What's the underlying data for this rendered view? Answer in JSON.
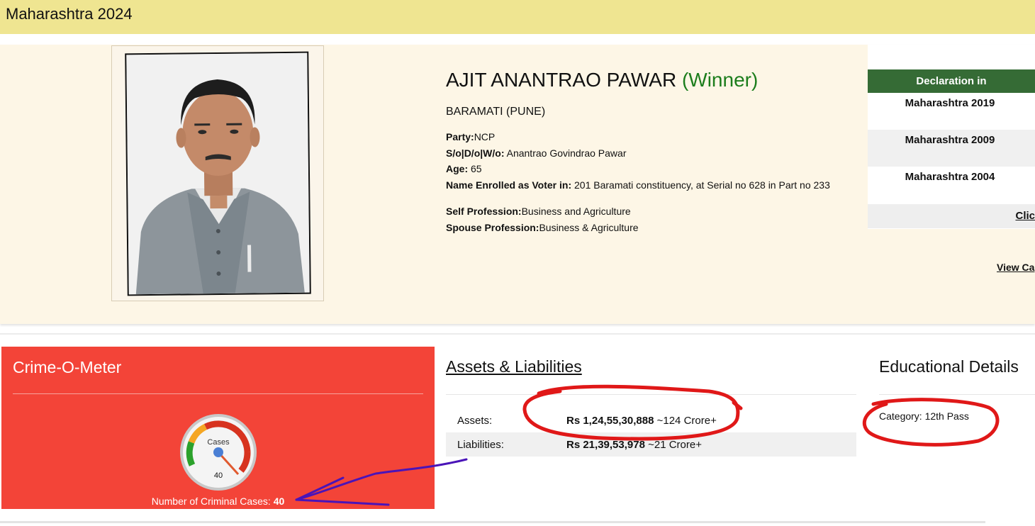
{
  "page_title": "Maharashtra 2024",
  "candidate": {
    "name": "AJIT ANANTRAO PAWAR",
    "status": "(Winner)",
    "constituency": "BARAMATI (PUNE)",
    "details": {
      "party_label": "Party:",
      "party_value": "NCP",
      "relation_label": "S/o|D/o|W/o:",
      "relation_value": "Anantrao Govindrao Pawar",
      "age_label": "Age:",
      "age_value": "65",
      "voter_label": "Name Enrolled as Voter in:",
      "voter_value": "201 Baramati constituency, at Serial no 628 in Part no 233",
      "self_prof_label": "Self Profession:",
      "self_prof_value": "Business and Agriculture",
      "spouse_prof_label": "Spouse Profession:",
      "spouse_prof_value": "Business & Agriculture"
    }
  },
  "declarations": {
    "header": "Declaration in",
    "items": [
      "Maharashtra 2019",
      "Maharashtra 2009",
      "Maharashtra 2004"
    ],
    "click_link": "Clic"
  },
  "view_cases_link": "View Ca",
  "crime_meter": {
    "title": "Crime-O-Meter",
    "gauge_label": "Cases",
    "gauge_value": "40",
    "count_label": "Number of Criminal Cases:",
    "count_value": "40"
  },
  "assets": {
    "title": "Assets & Liabilities",
    "rows": [
      {
        "label": "Assets:",
        "value": "Rs 1,24,55,30,888",
        "approx": "~124 Crore+"
      },
      {
        "label": "Liabilities:",
        "value": "Rs 21,39,53,978",
        "approx": "~21 Crore+"
      }
    ]
  },
  "education": {
    "title": "Educational Details",
    "category": "Category: 12th Pass"
  },
  "colors": {
    "top_bar": "#efe591",
    "hero_bg": "#fdf6e6",
    "winner": "#1c7d1c",
    "declaration_header": "#356b35",
    "crime_panel": "#f34438",
    "annotation_red": "#e01818",
    "annotation_blue": "#4a14b8"
  }
}
